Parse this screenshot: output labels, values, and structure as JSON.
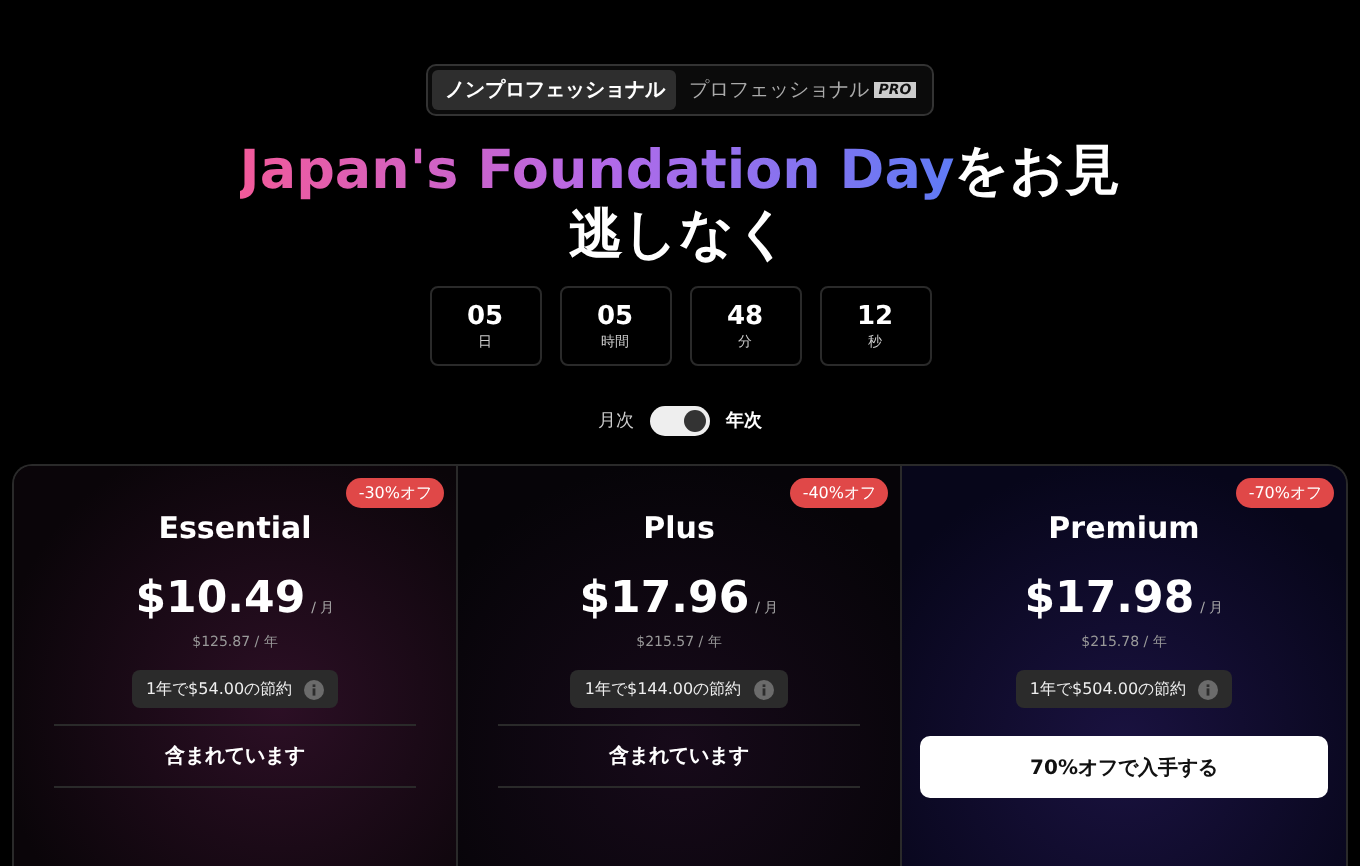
{
  "tabs": [
    {
      "label": "ノンプロフェッショナル",
      "selected": true
    },
    {
      "label": "プロフェッショナル",
      "selected": false,
      "badge": "PRO"
    }
  ],
  "headline": {
    "highlight": "Japan's Foundation Day",
    "rest": "をお見逃しなく"
  },
  "countdown": [
    {
      "value": "05",
      "unit": "日"
    },
    {
      "value": "05",
      "unit": "時間"
    },
    {
      "value": "48",
      "unit": "分"
    },
    {
      "value": "12",
      "unit": "秒"
    }
  ],
  "billing": {
    "monthly": "月次",
    "yearly": "年次",
    "on": true
  },
  "plans": [
    {
      "name": "Essential",
      "badge": "-30%オフ",
      "price": "$10.49",
      "per": "/ 月",
      "yearly": "$125.87 / 年",
      "savings": "1年で$54.00の節約",
      "kind": "included",
      "action": "含まれています"
    },
    {
      "name": "Plus",
      "badge": "-40%オフ",
      "price": "$17.96",
      "per": "/ 月",
      "yearly": "$215.57 / 年",
      "savings": "1年で$144.00の節約",
      "kind": "included",
      "action": "含まれています"
    },
    {
      "name": "Premium",
      "badge": "-70%オフ",
      "price": "$17.98",
      "per": "/ 月",
      "yearly": "$215.78 / 年",
      "savings": "1年で$504.00の節約",
      "kind": "button",
      "action": "70%オフで入手する"
    }
  ]
}
